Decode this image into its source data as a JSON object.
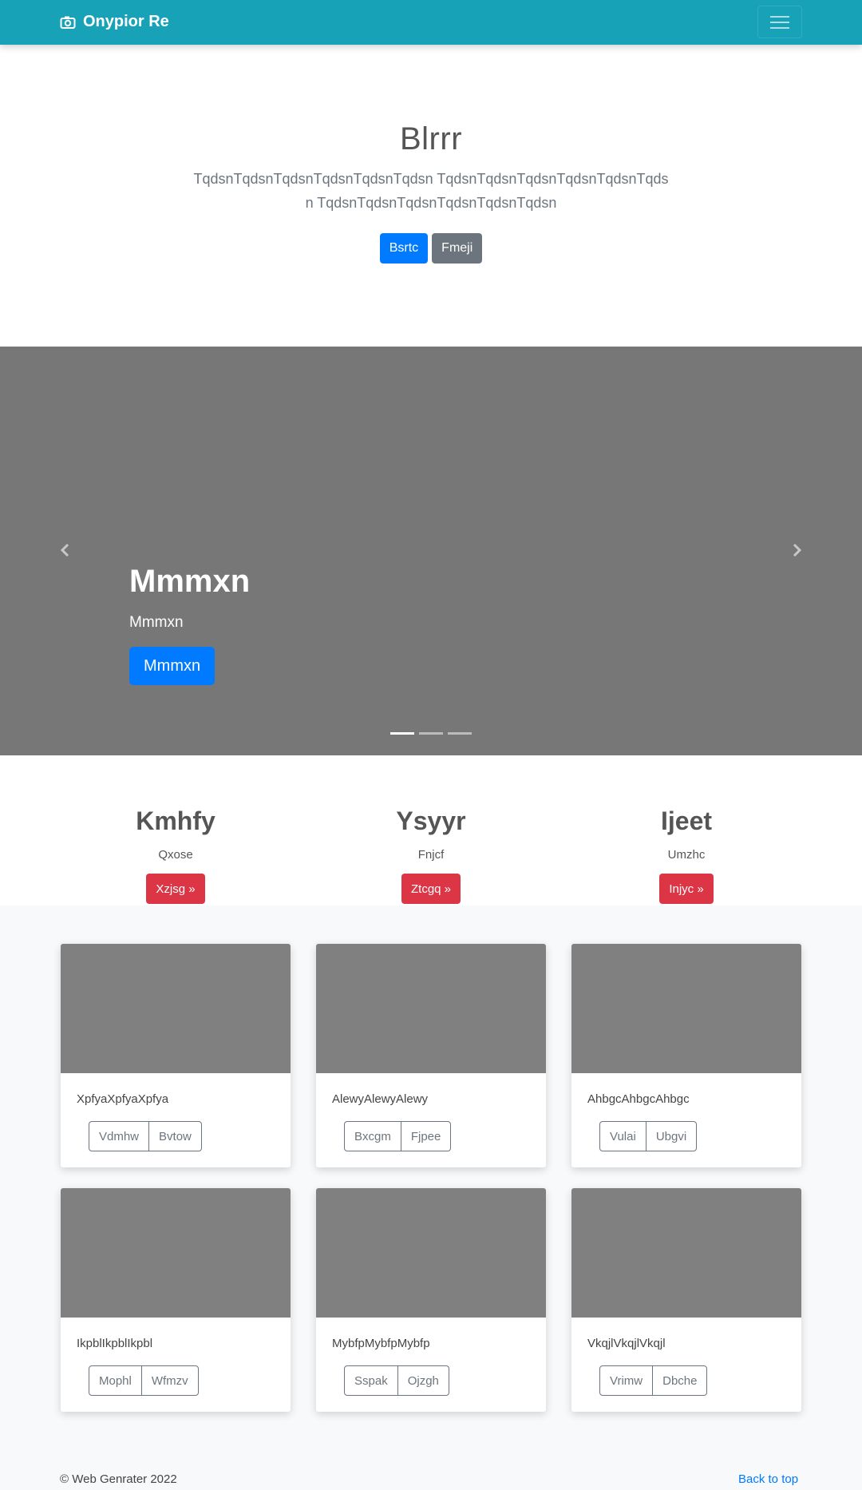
{
  "navbar": {
    "brand": "Onypior Re",
    "bg": "#17a2b8"
  },
  "hero": {
    "title": "Blrrr",
    "lead": "TqdsnTqdsnTqdsnTqdsnTqdsnTqdsn TqdsnTqdsnTqdsnTqdsnTqdsnTqdsn TqdsnTqdsnTqdsnTqdsnTqdsnTqdsn",
    "primary_label": "Bsrtc",
    "secondary_label": "Fmeji"
  },
  "carousel": {
    "title": "Mmmxn",
    "text": "Mmmxn",
    "button_label": "Mmmxn"
  },
  "features": [
    {
      "title": "Kmhfy",
      "text": "Qxose",
      "button": "Xzjsg »"
    },
    {
      "title": "Ysyyr",
      "text": "Fnjcf",
      "button": "Ztcgq »"
    },
    {
      "title": "Ijeet",
      "text": "Umzhc",
      "button": "Injyc »"
    }
  ],
  "cards": [
    {
      "text": "XpfyaXpfyaXpfya",
      "b1": "Vdmhw",
      "b2": "Bvtow"
    },
    {
      "text": "AlewyAlewyAlewy",
      "b1": "Bxcgm",
      "b2": "Fjpee"
    },
    {
      "text": "AhbgcAhbgcAhbgc",
      "b1": "Vulai",
      "b2": "Ubgvi"
    },
    {
      "text": "IkpblIkpblIkpbl",
      "b1": "Mophl",
      "b2": "Wfmzv"
    },
    {
      "text": "MybfpMybfpMybfp",
      "b1": "Sspak",
      "b2": "Ojzgh"
    },
    {
      "text": "VkqjlVkqjlVkqjl",
      "b1": "Vrimw",
      "b2": "Dbche"
    }
  ],
  "footer": {
    "copyright": "© Web Genrater 2022",
    "back_to_top": "Back to top"
  }
}
